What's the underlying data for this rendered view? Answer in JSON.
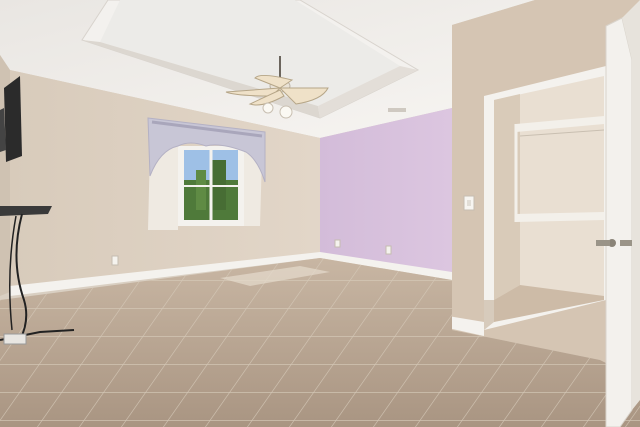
{
  "scene": {
    "kind": "interior-room-photo",
    "colors": {
      "ceiling": "#f1efec",
      "ceiling_shadow": "#dcd8d3",
      "wall_beige": "#ddd0c1",
      "wall_lavender": "#d7bfdc",
      "right_wall": "#d6c6b4",
      "trim": "#f4f2ee",
      "floor_tile": "#b7a592",
      "floor_grout": "#d2c4b3",
      "closet_interior": "#e9dfd2",
      "door": "#f3f1ed",
      "valance": "#c8c6d6",
      "window_glass": "#9ec0e6",
      "tree_green": "#4f7a3a"
    },
    "icons": [
      "ceiling-fan-icon",
      "tv-icon",
      "window-icon",
      "door-icon",
      "light-switch-icon",
      "outlet-icon",
      "closet-shelf-icon"
    ]
  }
}
